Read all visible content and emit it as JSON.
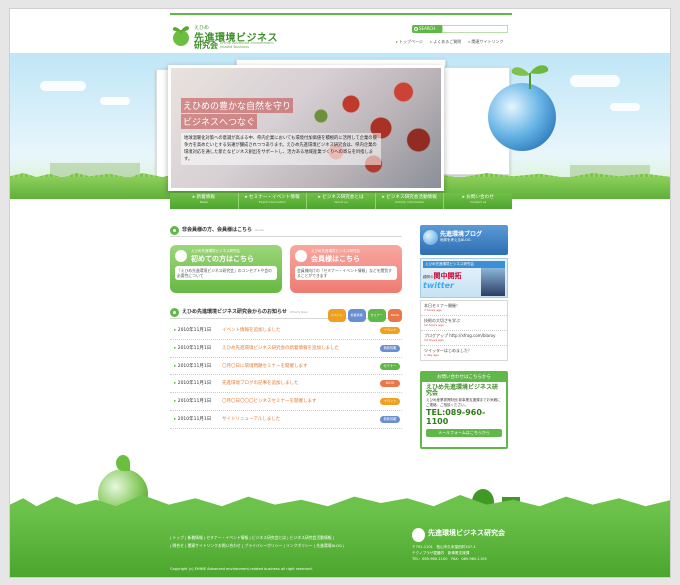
{
  "header": {
    "logo_small": "えひめ",
    "logo_main": "先進環境ビジネス",
    "logo_sub": "研究会",
    "logo_en": "Ehime Advanced Environment-related Business",
    "search_label": "SEARCH",
    "util_links": [
      "トップページ",
      "よくあるご質問",
      "関連サイトリンク"
    ]
  },
  "hero": {
    "headline1": "えひめの豊かな自然を守り",
    "headline2": "ビジネスへつなぐ",
    "body": "地球温暖化対策への意識が高まる中、県内企業においても環境付加価値を積極的に活用して企業の競争力を高めたいとする気運が醸成されつつあります。えひめ先進環境ビジネス研究会は、県内企業の環境対応を通した新たなビジネス創出をサポートし、活力ある地域産業づくりへの寄与を目指します。"
  },
  "nav": [
    {
      "label": "新着情報",
      "en": "News"
    },
    {
      "label": "セミナー・イベント情報",
      "en": "Event information"
    },
    {
      "label": "ビジネス研究会とは",
      "en": "About us"
    },
    {
      "label": "ビジネス研究会活動情報",
      "en": "Activity information"
    },
    {
      "label": "お問い合わせ",
      "en": "Contact us"
    }
  ],
  "members": {
    "title": "非会員様の方、会員様はこちら",
    "title_en": "Guide",
    "first": {
      "small": "えひめ先進環境ビジネス研究会",
      "big": "初めての方はこちら",
      "desc": "「えひめ先進環境ビジネス研究会」のコンセプトや会の必要性について"
    },
    "member": {
      "small": "えひめ先進環境ビジネス研究会",
      "big": "会員様はこちら",
      "desc": "会員様向けの「セミナー・イベント情報」などを閲覧することができます"
    }
  },
  "news": {
    "title": "えひめ先進環境ビジネス研究会からのお知らせ",
    "title_en": "What's New",
    "tags": [
      {
        "label": "イベント",
        "color": "#f0a020"
      },
      {
        "label": "新着情報",
        "color": "#6a8fd0"
      },
      {
        "label": "セミナー",
        "color": "#5fb847"
      },
      {
        "label": "BLOG",
        "color": "#e8784a"
      }
    ],
    "items": [
      {
        "date": "2010年11月1日",
        "title": "イベント情報を追加しました",
        "label": "イベント",
        "color": "#f0a020"
      },
      {
        "date": "2010年11月1日",
        "title": "えひめ先進環境ビジネス研究会の新着情報を追加しました",
        "label": "新着情報",
        "color": "#6a8fd0"
      },
      {
        "date": "2010年11月1日",
        "title": "〇月〇日に環境問題セミナーを開催します",
        "label": "セミナー",
        "color": "#5fb847"
      },
      {
        "date": "2010年11月1日",
        "title": "先進環境ブログの記事を追加しました",
        "label": "BLOG",
        "color": "#e8784a"
      },
      {
        "date": "2010年11月1日",
        "title": "〇月〇日〇〇〇ビジネスセミナーを開催します",
        "label": "イベント",
        "color": "#f0a020"
      },
      {
        "date": "2010年11月1日",
        "title": "サイトリニューアルしました",
        "label": "新着情報",
        "color": "#6a8fd0"
      }
    ]
  },
  "sidebar": {
    "blog_title": "先進環境ブログ",
    "blog_sub": "地球を考えるBLOG",
    "twitter_bar": "えひめ先進環境ビジネス研究会",
    "twitter_name_pre": "顧問の",
    "twitter_name": "関中開拓",
    "twitter_logo": "twitter",
    "feed": [
      {
        "text": "本日セミナー開催！",
        "time": "7 hours ago"
      },
      {
        "text": "技術の大切さを学ぶ",
        "time": "12 hours ago"
      },
      {
        "text": "ブログアップ http://xfrog.com/blaroy",
        "time": "14 hours ago"
      },
      {
        "text": "ツイッターはじめました！",
        "time": "1 day ago"
      }
    ],
    "contact_header": "お問い合わせはこちらから",
    "contact_logo": "えひめ先進環境ビジネス研究会",
    "contact_text": "えひめ産業振興財団 新事業支援課までお気軽にご連絡、ご相談ください。",
    "contact_tel": "TEL:089-960-1100",
    "contact_mail": "メールフォームはこちらから"
  },
  "footer": {
    "links1": "| トップ | 新着情報 | セミナー・イベント情報 | ビジネス研究会とは | ビジネス研究会活動情報 |",
    "links2": "| 問合せ | 関連サイトリンクお問い合わせ | プライバシーポリシー | リンクポリシー | 先進環境BLOG |",
    "logo": "先進環境ビジネス研究会",
    "address1": "〒791-1101　松山市久米窪田町337-1",
    "address2": "テクノプラザ愛媛内　新事業支援課",
    "address3": "TEL：089-960-1100　FAX：089-960-1105",
    "copyright": "Copyright (c) EHIME Advanced environment-related business all right reserved."
  }
}
